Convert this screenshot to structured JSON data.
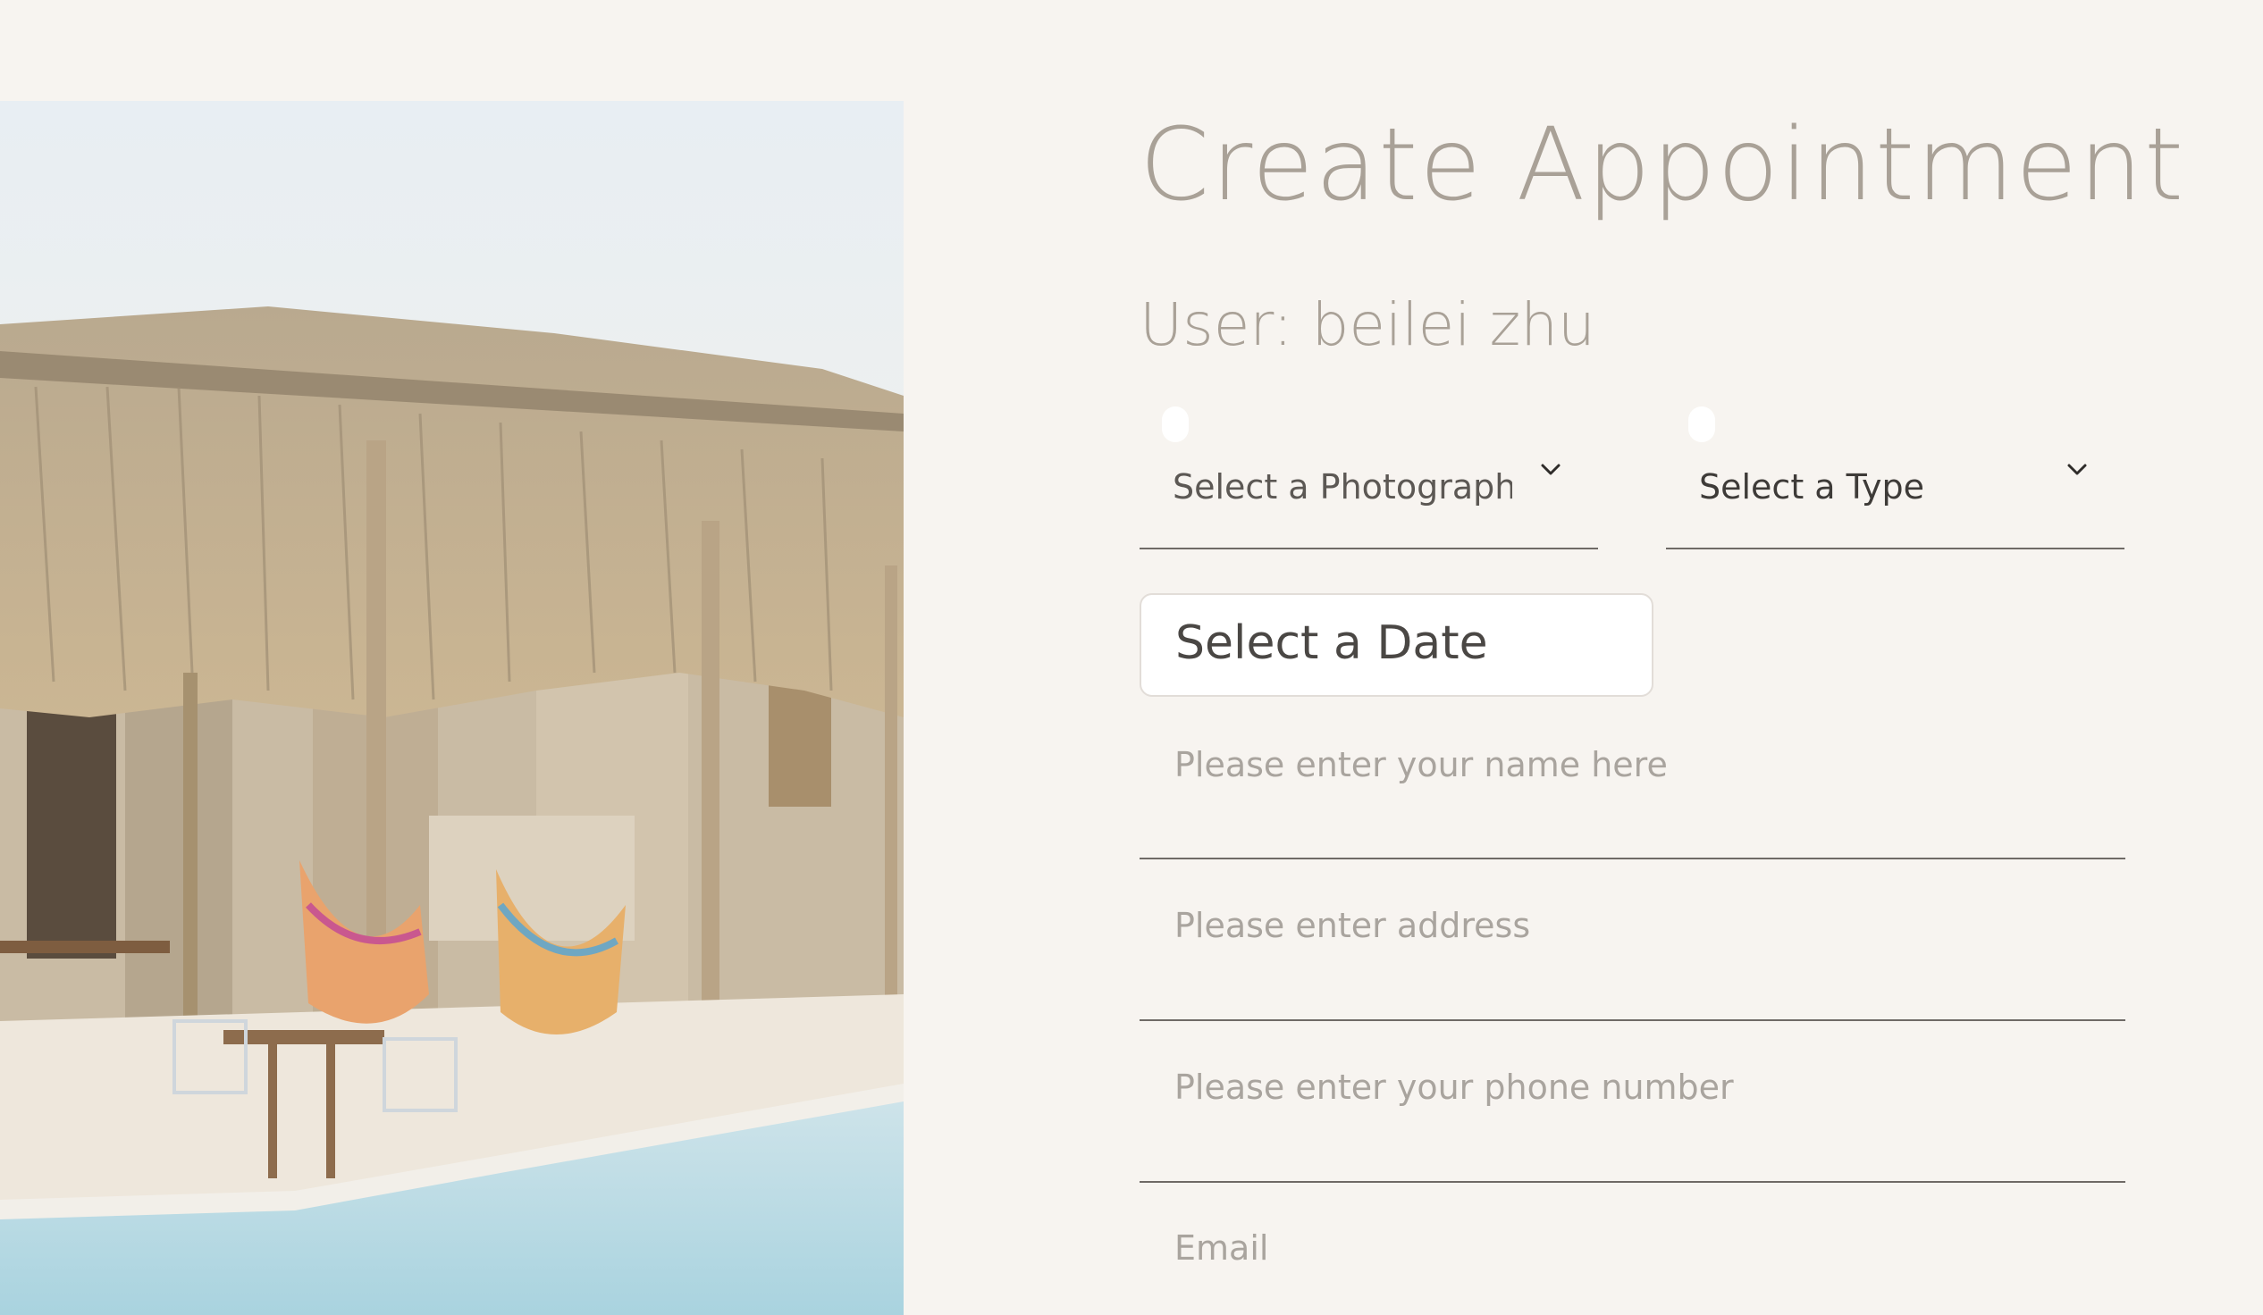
{
  "page": {
    "title": "Create Appointment",
    "user_line": "User: beilei zhu"
  },
  "form": {
    "photographer_select": {
      "value": "Select a Photographr",
      "icon": "chevron-down-icon"
    },
    "type_select": {
      "value": "Select a Type",
      "icon": "chevron-down-icon"
    },
    "date_field": {
      "value": "Select a Date"
    },
    "name_input": {
      "placeholder": "Please enter your name here"
    },
    "address_input": {
      "placeholder": "Please enter address"
    },
    "phone_input": {
      "placeholder": "Please enter your phone number"
    },
    "email_input": {
      "placeholder": "Email"
    }
  },
  "colors": {
    "background": "#f7f4f0",
    "title_text": "#a9a197",
    "underline": "#6f6a66",
    "placeholder": "#a9a49e"
  }
}
